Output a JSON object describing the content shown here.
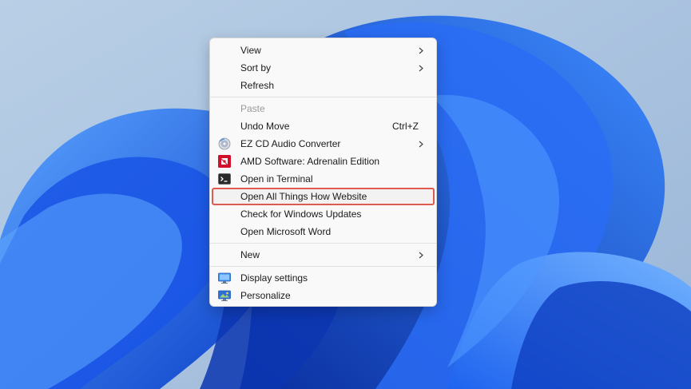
{
  "menu": {
    "group1": [
      {
        "label": "View",
        "submenu": true
      },
      {
        "label": "Sort by",
        "submenu": true
      },
      {
        "label": "Refresh"
      }
    ],
    "group2": [
      {
        "label": "Paste",
        "disabled": true
      },
      {
        "label": "Undo Move",
        "shortcut": "Ctrl+Z"
      },
      {
        "label": "EZ CD Audio Converter",
        "icon": "cd-icon",
        "submenu": true
      },
      {
        "label": "AMD Software: Adrenalin Edition",
        "icon": "amd-icon"
      },
      {
        "label": "Open in Terminal",
        "icon": "terminal-icon"
      },
      {
        "label": "Open All Things How Website",
        "highlighted": true
      },
      {
        "label": "Check for Windows Updates"
      },
      {
        "label": "Open Microsoft Word"
      }
    ],
    "group3": [
      {
        "label": "New",
        "submenu": true
      }
    ],
    "group4": [
      {
        "label": "Display settings",
        "icon": "display-icon"
      },
      {
        "label": "Personalize",
        "icon": "personalize-icon"
      }
    ]
  },
  "colors": {
    "highlight_border": "#e05a4f",
    "wallpaper_blue": "#1a5ff0",
    "wallpaper_bg": "#a9c3e0"
  }
}
